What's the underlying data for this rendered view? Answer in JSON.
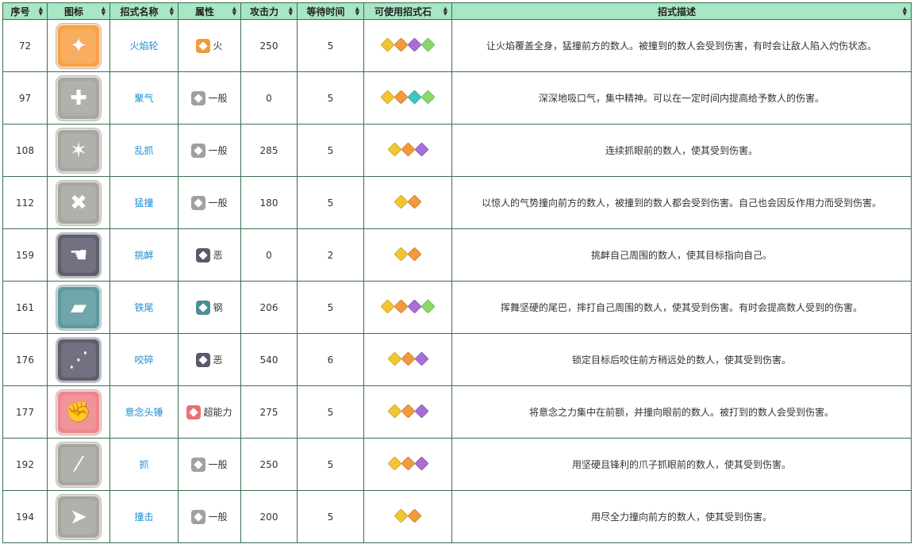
{
  "headers": {
    "index": "序号",
    "icon": "图标",
    "name": "招式名称",
    "type": "属性",
    "power": "攻击力",
    "wait": "等待时间",
    "stones": "可使用招式石",
    "desc": "招式描述"
  },
  "stone_colors": {
    "yellow": "#f2c630",
    "orange": "#f29a3c",
    "purple": "#a96ed6",
    "teal": "#3cc6c0",
    "green": "#8ad86a"
  },
  "type_colors": {
    "fire": "#f29a3c",
    "normal": "#a0a0a0",
    "dark": "#5a5a6a",
    "steel": "#4a8e96",
    "psychic": "#e8707a"
  },
  "rows": [
    {
      "index": "72",
      "name": "火焰轮",
      "type": "火",
      "type_key": "fire",
      "power": "250",
      "wait": "5",
      "stones": [
        "yellow",
        "orange",
        "purple",
        "green"
      ],
      "icon": "fire-wheel-icon",
      "icon_color": "#f7a24a",
      "desc": "让火焰覆盖全身，猛撞前方的数人。被撞到的数人会受到伤害，有时会让敌人陷入灼伤状态。"
    },
    {
      "index": "97",
      "name": "聚气",
      "type": "一般",
      "type_key": "normal",
      "power": "0",
      "wait": "5",
      "stones": [
        "yellow",
        "orange",
        "teal",
        "green"
      ],
      "icon": "focus-energy-icon",
      "icon_color": "#a7a7a0",
      "desc": "深深地吸口气，集中精神。可以在一定时间内提高给予数人的伤害。"
    },
    {
      "index": "108",
      "name": "乱抓",
      "type": "一般",
      "type_key": "normal",
      "power": "285",
      "wait": "5",
      "stones": [
        "yellow",
        "orange",
        "purple"
      ],
      "icon": "fury-swipes-icon",
      "icon_color": "#a7a7a0",
      "desc": "连续抓眼前的数人，使其受到伤害。"
    },
    {
      "index": "112",
      "name": "猛撞",
      "type": "一般",
      "type_key": "normal",
      "power": "180",
      "wait": "5",
      "stones": [
        "yellow",
        "orange"
      ],
      "icon": "take-down-icon",
      "icon_color": "#a7a7a0",
      "desc": "以惊人的气势撞向前方的数人，被撞到的数人都会受到伤害。自己也会因反作用力而受到伤害。"
    },
    {
      "index": "159",
      "name": "挑衅",
      "type": "恶",
      "type_key": "dark",
      "power": "0",
      "wait": "2",
      "stones": [
        "yellow",
        "orange"
      ],
      "icon": "taunt-icon",
      "icon_color": "#5e5e70",
      "desc": "挑衅自己周围的数人，使其目标指向自己。"
    },
    {
      "index": "161",
      "name": "铁尾",
      "type": "钢",
      "type_key": "steel",
      "power": "206",
      "wait": "5",
      "stones": [
        "yellow",
        "orange",
        "purple",
        "green"
      ],
      "icon": "iron-tail-icon",
      "icon_color": "#5d9aa0",
      "desc": "挥舞坚硬的尾巴，摔打自己周围的数人，使其受到伤害。有时会提高数人受到的伤害。"
    },
    {
      "index": "176",
      "name": "咬碎",
      "type": "恶",
      "type_key": "dark",
      "power": "540",
      "wait": "6",
      "stones": [
        "yellow",
        "orange",
        "purple"
      ],
      "icon": "crunch-icon",
      "icon_color": "#5e5e70",
      "desc": "锁定目标后咬住前方稍远处的数人，使其受到伤害。"
    },
    {
      "index": "177",
      "name": "意念头锤",
      "type": "超能力",
      "type_key": "psychic",
      "power": "275",
      "wait": "5",
      "stones": [
        "yellow",
        "orange",
        "purple"
      ],
      "icon": "zen-headbutt-icon",
      "icon_color": "#ee868d",
      "desc": "将意念之力集中在前额，并撞向眼前的数人。被打到的数人会受到伤害。"
    },
    {
      "index": "192",
      "name": "抓",
      "type": "一般",
      "type_key": "normal",
      "power": "250",
      "wait": "5",
      "stones": [
        "yellow",
        "orange",
        "purple"
      ],
      "icon": "scratch-icon",
      "icon_color": "#a7a7a0",
      "desc": "用坚硬且锋利的爪子抓眼前的数人，使其受到伤害。"
    },
    {
      "index": "194",
      "name": "撞击",
      "type": "一般",
      "type_key": "normal",
      "power": "200",
      "wait": "5",
      "stones": [
        "yellow",
        "orange"
      ],
      "icon": "tackle-icon",
      "icon_color": "#a7a7a0",
      "desc": "用尽全力撞向前方的数人，使其受到伤害。"
    }
  ]
}
